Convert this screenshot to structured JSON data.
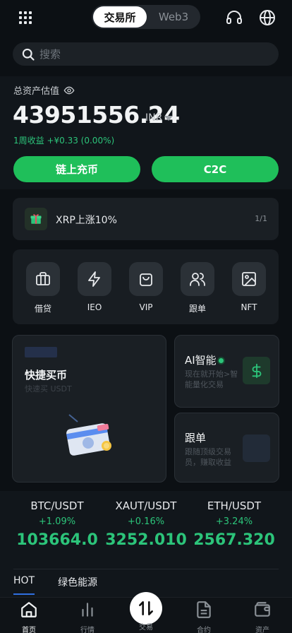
{
  "header": {
    "tabs": [
      {
        "label": "交易所",
        "active": true
      },
      {
        "label": "Web3",
        "active": false
      }
    ],
    "menu_icon": "grid-icon",
    "support_icon": "headset-icon",
    "language_icon": "globe-icon"
  },
  "search": {
    "placeholder": "搜索"
  },
  "asset": {
    "label": "总资产估值",
    "balance": "43951556.24",
    "currency": "INR",
    "weekly": "1周收益 +¥0.33 (0.00%)",
    "buttons": [
      "链上充币",
      "C2C"
    ]
  },
  "notice": {
    "text": "XRP上涨10%",
    "page": "1/1"
  },
  "shortcuts": [
    {
      "label": "借贷",
      "icon": "wallet-icon"
    },
    {
      "label": "IEO",
      "icon": "lightning-icon"
    },
    {
      "label": "VIP",
      "icon": "bag-icon"
    },
    {
      "label": "跟单",
      "icon": "users-icon"
    },
    {
      "label": "NFT",
      "icon": "image-icon"
    }
  ],
  "cards": {
    "quick_buy": {
      "title": "快捷买币",
      "subtitle": "快速买 USDT"
    },
    "ai": {
      "title": "AI智能",
      "subtitle": "现在就开始>智能量化交易"
    },
    "copy": {
      "title": "跟单",
      "subtitle": "跟随顶级交易员，赚取收益"
    }
  },
  "market": {
    "tickers": [
      {
        "pair": "BTC/USDT",
        "change": "+1.09%",
        "price": "103664.0"
      },
      {
        "pair": "XAUT/USDT",
        "change": "+0.16%",
        "price": "3252.010"
      },
      {
        "pair": "ETH/USDT",
        "change": "+3.24%",
        "price": "2567.320"
      }
    ],
    "tabs": [
      "HOT",
      "绿色能源"
    ]
  },
  "tabbar": [
    {
      "label": "首页",
      "icon": "home-icon"
    },
    {
      "label": "行情",
      "icon": "chart-icon"
    },
    {
      "label": "交易",
      "icon": "swap-icon"
    },
    {
      "label": "合约",
      "icon": "contract-icon"
    },
    {
      "label": "资产",
      "icon": "wallet-icon"
    }
  ],
  "colors": {
    "accent_green": "#1fbf5a",
    "up_green": "#2cc47a",
    "background": "#0c1014"
  }
}
